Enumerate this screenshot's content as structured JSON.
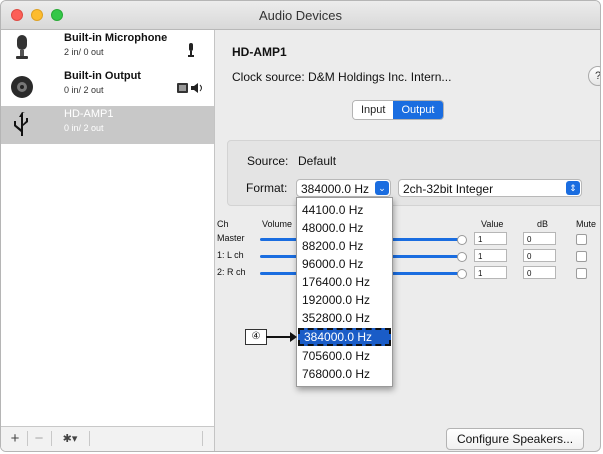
{
  "window": {
    "title": "Audio Devices"
  },
  "sidebar": {
    "devices": [
      {
        "name": "Built-in Microphone",
        "io": "2 in/ 0 out",
        "icon": "microphone-icon"
      },
      {
        "name": "Built-in Output",
        "io": "0 in/ 2 out",
        "icon": "speaker-icon"
      },
      {
        "name": "HD-AMP1",
        "io": "0 in/ 2 out",
        "icon": "usb-icon",
        "selected": true
      }
    ],
    "footer": {
      "add": "+",
      "remove": "−",
      "gear": "✱▾"
    }
  },
  "main": {
    "device_title": "HD-AMP1",
    "clock_source": "Clock source: D&M Holdings Inc. Intern...",
    "help": "?",
    "tabs": [
      {
        "label": "Input"
      },
      {
        "label": "Output",
        "active": true
      }
    ],
    "source": {
      "label": "Source:",
      "value": "Default"
    },
    "format": {
      "label": "Format:",
      "rate": "384000.0 Hz",
      "bitdepth": "2ch-32bit Integer"
    },
    "table": {
      "headers": {
        "ch": "Ch",
        "volume": "Volume",
        "value": "Value",
        "db": "dB",
        "mute": "Mute"
      },
      "rows": [
        {
          "ch": "Master",
          "value": "1",
          "db": "0"
        },
        {
          "ch": "1: L ch",
          "value": "1",
          "db": "0"
        },
        {
          "ch": "2: R ch",
          "value": "1",
          "db": "0"
        }
      ]
    },
    "rate_menu": [
      "44100.0 Hz",
      "48000.0 Hz",
      "88200.0 Hz",
      "96000.0 Hz",
      "176400.0 Hz",
      "192000.0 Hz",
      "352800.0 Hz",
      "384000.0 Hz",
      "705600.0 Hz",
      "768000.0 Hz"
    ],
    "callout": "④",
    "configure_speakers": "Configure Speakers..."
  },
  "colors": {
    "accent": "#1a6de0",
    "highlight": "#1a5cc7"
  }
}
